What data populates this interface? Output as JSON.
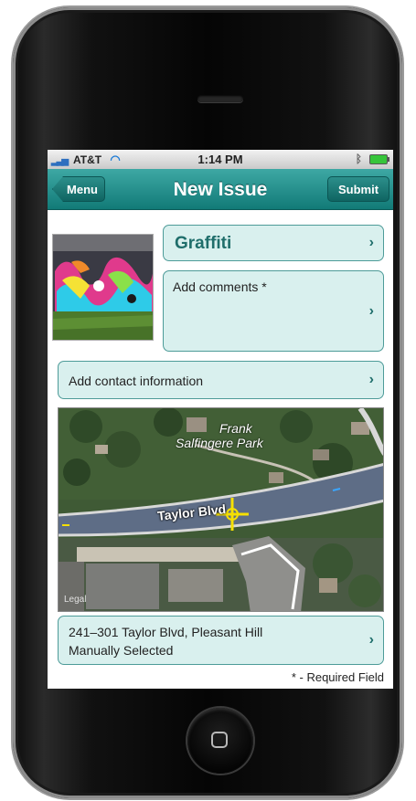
{
  "status_bar": {
    "carrier": "AT&T",
    "time": "1:14 PM",
    "signal_icon": "signal-bars-icon",
    "wifi_icon": "wifi-icon",
    "bluetooth_icon": "bluetooth-icon",
    "battery_icon": "battery-icon"
  },
  "nav": {
    "back_label": "Menu",
    "title": "New Issue",
    "submit_label": "Submit"
  },
  "issue": {
    "category": "Graffiti",
    "comments_placeholder": "Add comments *",
    "contact_label": "Add contact information"
  },
  "map": {
    "park_label_line1": "Frank",
    "park_label_line2": "Salfingere Park",
    "street_label": "Taylor Blvd",
    "legal_label": "Legal"
  },
  "location": {
    "address": "241–301 Taylor Blvd, Pleasant Hill",
    "mode": "Manually Selected"
  },
  "footer": {
    "required_note": "* - Required Field"
  },
  "colors": {
    "nav_bar": "#1f8c88",
    "cell_bg": "#d9f0ee",
    "cell_border": "#4d9b98",
    "category_text": "#1f6e6b"
  }
}
